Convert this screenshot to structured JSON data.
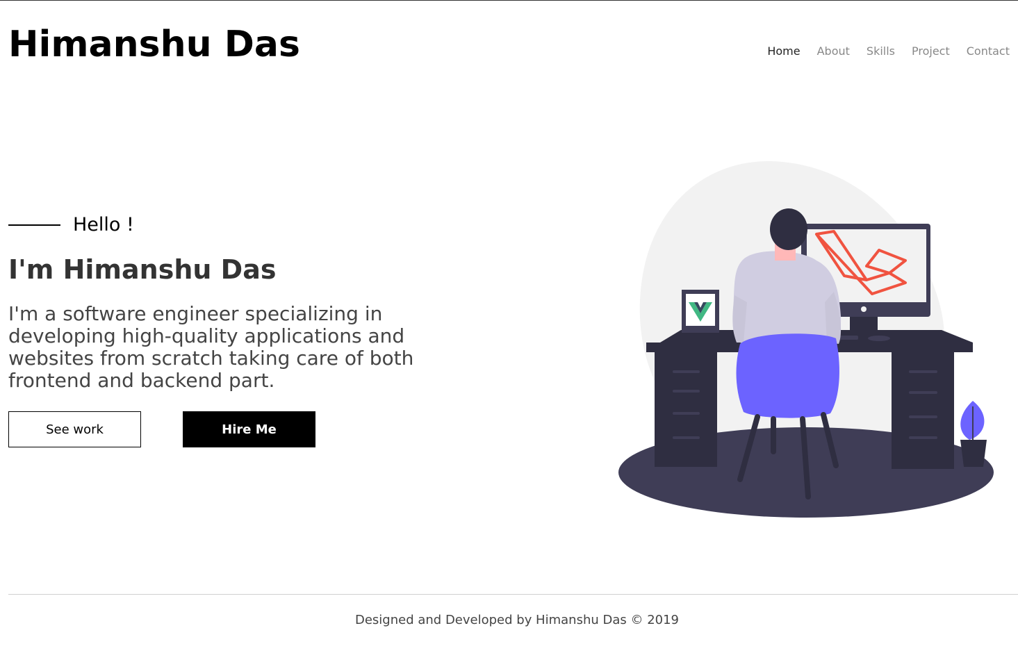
{
  "header": {
    "brand": "Himanshu Das",
    "nav": [
      "Home",
      "About",
      "Skills",
      "Project",
      "Contact"
    ]
  },
  "hero": {
    "greeting": "Hello !",
    "headline": "I'm Himanshu Das",
    "intro": "I'm a software engineer specializing in developing high-quality applications and websites from scratch taking care of both frontend and backend part.",
    "buttons": {
      "see_work": "See work",
      "hire_me": "Hire Me"
    }
  },
  "footer": {
    "text": "Designed and Developed by Himanshu Das © 2019"
  },
  "colors": {
    "accent_chair": "#6c63ff",
    "laravel_red": "#f05340",
    "vue_green": "#41b883",
    "desk_dark": "#2f2e41"
  },
  "icons": {
    "illustration": "developer-at-desk-illustration"
  }
}
